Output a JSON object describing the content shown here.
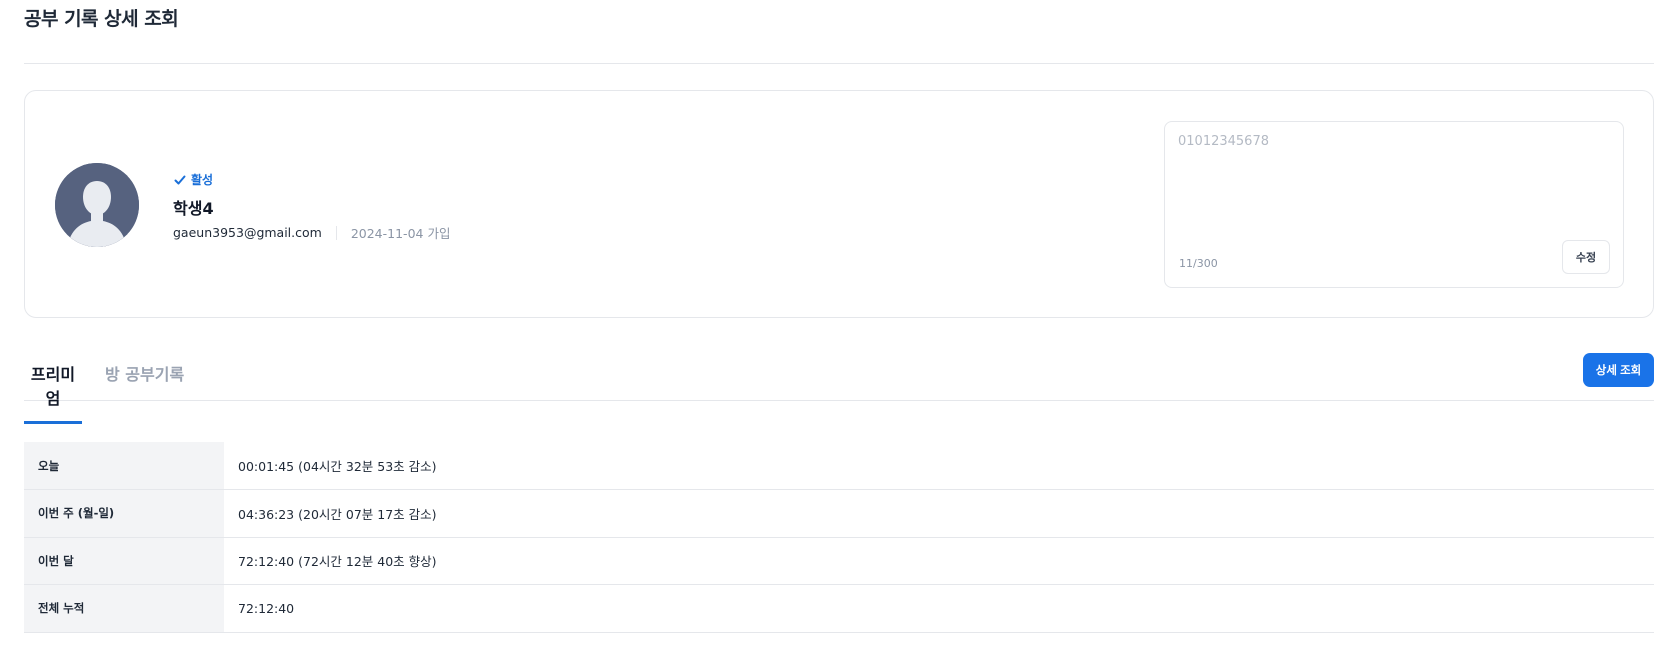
{
  "page": {
    "title": "공부 기록 상세 조회"
  },
  "profile": {
    "status": "활성",
    "name": "학생4",
    "email": "gaeun3953@gmail.com",
    "joined": "2024-11-04 가입"
  },
  "memo": {
    "value": "",
    "placeholder": "01012345678",
    "count": "11/300",
    "edit_label": "수정"
  },
  "tabs": [
    {
      "label": "프리미엄",
      "active": true
    },
    {
      "label": "방 공부기록",
      "active": false
    }
  ],
  "actions": {
    "detail_label": "상세 조회"
  },
  "stats": [
    {
      "label": "오늘",
      "value": "00:01:45 (04시간 32분 53초 감소)"
    },
    {
      "label": "이번 주 (월-일)",
      "value": "04:36:23 (20시간 07분 17초 감소)"
    },
    {
      "label": "이번 달",
      "value": "72:12:40 (72시간 12분 40초 향상)"
    },
    {
      "label": "전체 누적",
      "value": "72:12:40"
    }
  ],
  "colors": {
    "accent": "#1a73e8",
    "status": "#1a6fd8",
    "avatar_bg": "#56627f"
  },
  "icons": {
    "status": "check-icon",
    "avatar": "person-silhouette-icon"
  }
}
